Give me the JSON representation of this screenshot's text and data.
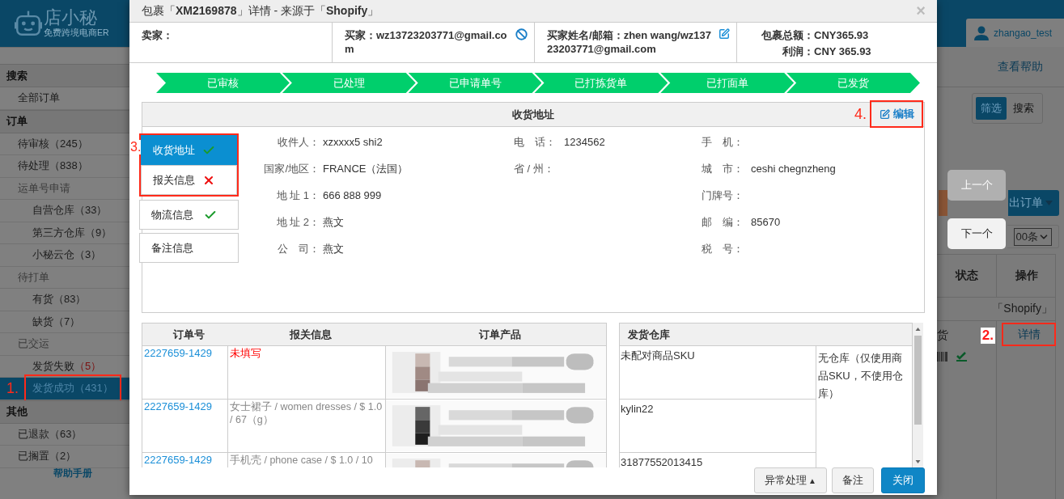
{
  "header": {
    "logo_name": "店小秘",
    "logo_tagline": "免费跨境电商ER",
    "user": "zhangao_test"
  },
  "sidebar": {
    "sections": [
      {
        "title": "搜索",
        "items": [
          {
            "label": "全部订单",
            "selected": false
          }
        ]
      },
      {
        "title": "订单",
        "items": [
          {
            "label": "待审核",
            "count": "（245）",
            "alert": false,
            "selected": false
          },
          {
            "label": "待处理",
            "count": "（838）",
            "alert": false,
            "selected": false
          },
          {
            "label": "运单号申请",
            "selected": false,
            "children": [
              {
                "label": "自营仓库",
                "count": "（33）",
                "alert": false,
                "selected": false
              },
              {
                "label": "第三方仓库",
                "count": "（9）",
                "alert": false,
                "selected": false
              },
              {
                "label": "小秘云仓",
                "count": "（3）",
                "alert": false,
                "selected": false
              }
            ]
          },
          {
            "label": "待打单",
            "selected": false,
            "children": [
              {
                "label": "有货",
                "count": "（83）",
                "alert": false,
                "selected": false
              },
              {
                "label": "缺货",
                "count": "（7）",
                "alert": false,
                "selected": false
              }
            ]
          },
          {
            "label": "已交运",
            "selected": false,
            "children": [
              {
                "label": "发货失败",
                "count": "（5）",
                "alert": true,
                "selected": false
              },
              {
                "label": "发货成功",
                "count": "（431）",
                "alert": false,
                "selected": true,
                "marker": "1."
              }
            ]
          }
        ]
      },
      {
        "title": "其他",
        "items": [
          {
            "label": "已退款",
            "count": "（63）",
            "alert": false,
            "selected": false
          },
          {
            "label": "已搁置",
            "count": "（2）",
            "alert": false,
            "selected": false
          }
        ]
      }
    ],
    "help_link": "帮助手册"
  },
  "main": {
    "help_button": "查看帮助",
    "view_toggle": [
      {
        "label": "筛选",
        "selected": true
      },
      {
        "label": "搜索",
        "selected": false
      }
    ],
    "export_button": "出订单",
    "page_size": "00条",
    "columns": [
      "状态",
      "操作"
    ],
    "rows": [
      {
        "shop": "「Shopify」",
        "status": "货",
        "action": "详情",
        "action_marker": "2."
      }
    ]
  },
  "nav_buttons": [
    {
      "label": "上一个",
      "disabled": true
    },
    {
      "label": "下一个",
      "disabled": false
    }
  ],
  "modal": {
    "title": "包裹「**XM2169878**」详情 - 来源于「**Shopify**」",
    "close": "×",
    "info": [
      {
        "kind": "plain",
        "label": "卖家："
      },
      {
        "kind": "blockable",
        "label": "买家：",
        "value": "wz13723203771@gmail.com"
      },
      {
        "kind": "editable",
        "label": "买家姓名/邮箱：",
        "value": "zhen wang/wz13723203771@gmail.com"
      },
      {
        "kind": "amount",
        "lines": [
          {
            "label": "包裹总额：",
            "value": "CNY365.93"
          },
          {
            "label": "利润：",
            "value": "CNY 365.93"
          }
        ]
      }
    ],
    "steps": [
      {
        "label": "已审核",
        "done": true
      },
      {
        "label": "已处理",
        "done": true
      },
      {
        "label": "已申请单号",
        "done": true
      },
      {
        "label": "已打拣货单",
        "done": true
      },
      {
        "label": "已打面单",
        "done": true
      },
      {
        "label": "已发货",
        "done": true
      }
    ],
    "address": {
      "title": "收货地址",
      "edit": "编辑",
      "edit_marker": "4.",
      "tabs_marker": "3.",
      "tabs": [
        {
          "label": "收货地址",
          "selected": true,
          "valid": true,
          "marked": true
        },
        {
          "label": "报关信息",
          "selected": false,
          "valid": false,
          "marked": true
        },
        {
          "label": "物流信息",
          "selected": false,
          "valid": true,
          "marked": false
        },
        {
          "label": "备注信息",
          "selected": false,
          "marked": false
        }
      ],
      "columns": [
        [
          {
            "label": "收件人：",
            "value": "xzxxxx5 shi2"
          },
          {
            "label": "国家/地区：",
            "value": "FRANCE（法国）"
          },
          {
            "label": "地 址 1：",
            "value": "666 888 999"
          },
          {
            "label": "地 址 2：",
            "value": "燕文"
          },
          {
            "label": "公　司：",
            "value": "燕文"
          }
        ],
        [
          {
            "label": "电　话：",
            "value": "1234562"
          },
          {
            "label": "省 / 州："
          }
        ],
        [
          {
            "label": "手　机："
          },
          {
            "label": "城　市：",
            "value": "ceshi chegnzheng"
          },
          {
            "label": "门牌号："
          },
          {
            "label": "邮　编：",
            "value": "85670"
          },
          {
            "label": "税　号："
          }
        ]
      ]
    },
    "orders": {
      "columns": [
        "订单号",
        "报关信息",
        "订单产品"
      ],
      "rows": [
        {
          "order": "2227659-1429",
          "customs": "未填写",
          "customs_missing": true
        },
        {
          "order": "2227659-1429",
          "customs": "女士裙子 / women dresses / $ 1.0 / 67（g）",
          "customs_missing": false
        },
        {
          "order": "2227659-1429",
          "customs": "手机壳 / phone case / $ 1.0 / 10",
          "customs_missing": false
        }
      ]
    },
    "warehouse": {
      "title": "发货仓库",
      "skus": [
        "未配对商品SKU",
        "kylin22",
        "31877552013415"
      ],
      "warehouse": "无仓库（仅使用商品SKU，不使用仓库）"
    },
    "footer": [
      {
        "label": "异常处理",
        "caret": "▲",
        "kind": "default"
      },
      {
        "label": "备注",
        "kind": "default"
      },
      {
        "label": "关闭",
        "kind": "primary"
      }
    ]
  }
}
